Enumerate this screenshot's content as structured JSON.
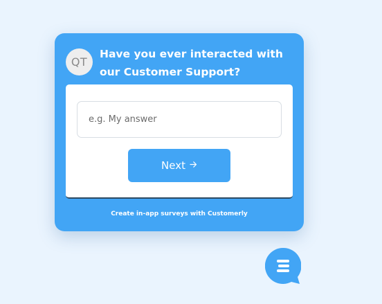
{
  "survey": {
    "avatar_initials": "QT",
    "question": "Have you ever interacted with our Customer Support?",
    "input_placeholder": "e.g. My answer",
    "input_value": "",
    "next_label": "Next",
    "next_icon": "arrow-right-icon",
    "footer_text": "Create in-app surveys with Customerly"
  },
  "launcher": {
    "icon": "chat-menu-icon"
  },
  "colors": {
    "background": "#eaf4fe",
    "accent": "#42a5f5",
    "panel": "#ffffff",
    "avatar_bg": "#eeeeee"
  }
}
